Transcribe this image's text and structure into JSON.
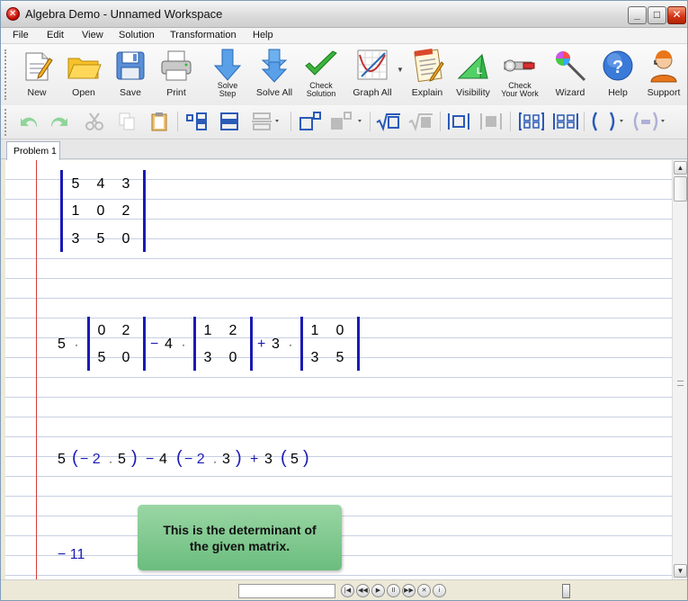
{
  "window": {
    "title": "Algebra Demo - Unnamed Workspace",
    "min": "_",
    "max": "□",
    "close": "✕"
  },
  "menu": [
    "File",
    "Edit",
    "View",
    "Solution",
    "Transformation",
    "Help"
  ],
  "toolbar": {
    "new": "New",
    "open": "Open",
    "save": "Save",
    "print": "Print",
    "solve_step_1": "Solve",
    "solve_step_2": "Step",
    "solve_all": "Solve All",
    "check_solution_1": "Check",
    "check_solution_2": "Solution",
    "graph_all": "Graph All",
    "explain": "Explain",
    "visibility": "Visibility",
    "check_work_1": "Check",
    "check_work_2": "Your Work",
    "wizard": "Wizard",
    "help": "Help",
    "support": "Support",
    "visibility_icon_letter": "L"
  },
  "tab": "Problem 1",
  "math": {
    "matrix": [
      [
        "5",
        "4",
        "3"
      ],
      [
        "1",
        "0",
        "2"
      ],
      [
        "3",
        "5",
        "0"
      ]
    ],
    "expansion": {
      "c1": "5",
      "op1": "·",
      "m1": [
        [
          "0",
          "2"
        ],
        [
          "5",
          "0"
        ]
      ],
      "minus": "−",
      "c2": "4",
      "op2": "·",
      "m2": [
        [
          "1",
          "2"
        ],
        [
          "3",
          "0"
        ]
      ],
      "plus": "+",
      "c3": "3",
      "op3": "·",
      "m3": [
        [
          "1",
          "0"
        ],
        [
          "3",
          "5"
        ]
      ]
    },
    "line3": {
      "a": "5",
      "lp1": "(",
      "n1": "− 2",
      "dot1": "·",
      "v1": "5",
      "rp1": ")",
      "minus": "−",
      "b": "4",
      "lp2": "(",
      "n2": "− 2",
      "dot2": "·",
      "v2": "3",
      "rp2": ")",
      "plus": "+",
      "c": "3",
      "lp3": "(",
      "v3": "5",
      "rp3": ")"
    },
    "result": "− 11"
  },
  "tooltip": {
    "line1": "This is the determinant of",
    "line2": "the given matrix."
  },
  "colors": {
    "accent_blue": "#1a1ab4",
    "margin_red": "#d83a3a",
    "tip_green": "#7cc88c"
  }
}
